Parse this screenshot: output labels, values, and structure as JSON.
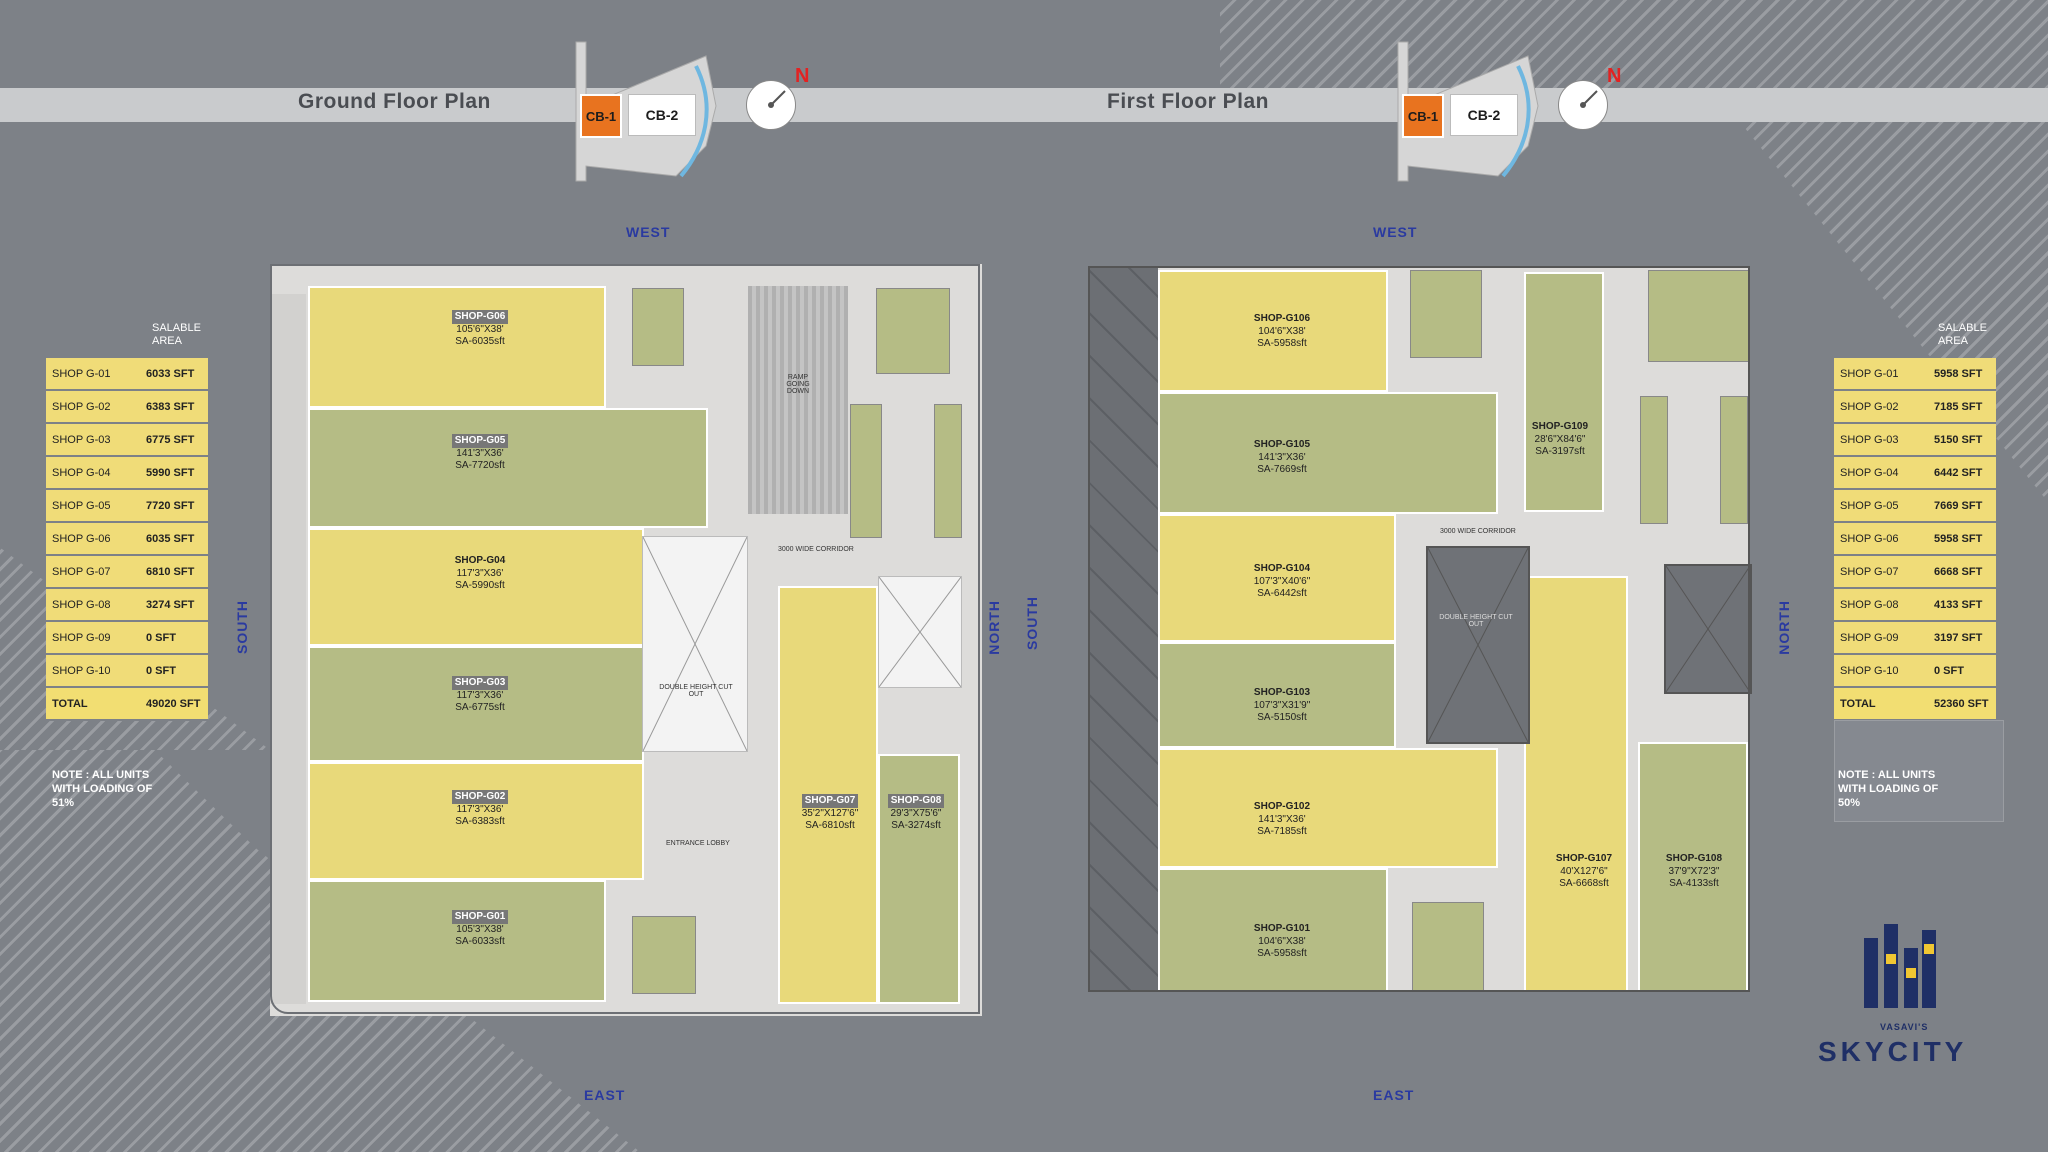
{
  "ground": {
    "title": "Ground Floor Plan",
    "key_cb1": "CB-1",
    "key_cb2": "CB-2",
    "north": "N",
    "dir_west": "WEST",
    "dir_east": "EAST",
    "dir_south": "SOUTH",
    "dir_north": "NORTH",
    "col_head": "SALABLE AREA",
    "rows": [
      {
        "name": "SHOP G-01",
        "value": "6033 SFT"
      },
      {
        "name": "SHOP G-02",
        "value": "6383 SFT"
      },
      {
        "name": "SHOP G-03",
        "value": "6775 SFT"
      },
      {
        "name": "SHOP G-04",
        "value": "5990 SFT"
      },
      {
        "name": "SHOP G-05",
        "value": "7720 SFT"
      },
      {
        "name": "SHOP G-06",
        "value": "6035 SFT"
      },
      {
        "name": "SHOP G-07",
        "value": "6810 SFT"
      },
      {
        "name": "SHOP G-08",
        "value": "3274 SFT"
      },
      {
        "name": "SHOP G-09",
        "value": "0 SFT"
      },
      {
        "name": "SHOP G-10",
        "value": "0 SFT"
      }
    ],
    "total_label": "TOTAL",
    "total_value": "49020 SFT",
    "note": "NOTE : ALL UNITS WITH LOADING OF 51%",
    "shops": [
      {
        "name": "SHOP-G06",
        "dim": "105'6\"X38'",
        "sa": "SA-6035sft"
      },
      {
        "name": "SHOP-G05",
        "dim": "141'3\"X36'",
        "sa": "SA-7720sft"
      },
      {
        "name": "SHOP-G04",
        "dim": "117'3\"X36'",
        "sa": "SA-5990sft"
      },
      {
        "name": "SHOP-G03",
        "dim": "117'3\"X36'",
        "sa": "SA-6775sft"
      },
      {
        "name": "SHOP-G02",
        "dim": "117'3\"X36'",
        "sa": "SA-6383sft"
      },
      {
        "name": "SHOP-G01",
        "dim": "105'3\"X38'",
        "sa": "SA-6033sft"
      },
      {
        "name": "SHOP-G07",
        "dim": "35'2\"X127'6\"",
        "sa": "SA-6810sft"
      },
      {
        "name": "SHOP-G08",
        "dim": "29'3\"X75'6\"",
        "sa": "SA-3274sft"
      }
    ],
    "labels": {
      "ramp": "RAMP GOING DOWN",
      "entrance_lobby": "ENTRANCE LOBBY",
      "double_height": "DOUBLE HEIGHT CUT OUT",
      "corridor": "3000 WIDE CORRIDOR"
    }
  },
  "first": {
    "title": "First Floor Plan",
    "key_cb1": "CB-1",
    "key_cb2": "CB-2",
    "north": "N",
    "dir_west": "WEST",
    "dir_east": "EAST",
    "dir_south": "SOUTH",
    "dir_north": "NORTH",
    "col_head": "SALABLE AREA",
    "rows": [
      {
        "name": "SHOP G-01",
        "value": "5958 SFT"
      },
      {
        "name": "SHOP G-02",
        "value": "7185 SFT"
      },
      {
        "name": "SHOP G-03",
        "value": "5150 SFT"
      },
      {
        "name": "SHOP G-04",
        "value": "6442 SFT"
      },
      {
        "name": "SHOP G-05",
        "value": "7669 SFT"
      },
      {
        "name": "SHOP G-06",
        "value": "5958 SFT"
      },
      {
        "name": "SHOP G-07",
        "value": "6668 SFT"
      },
      {
        "name": "SHOP G-08",
        "value": "4133 SFT"
      },
      {
        "name": "SHOP G-09",
        "value": "3197 SFT"
      },
      {
        "name": "SHOP G-10",
        "value": "0 SFT"
      }
    ],
    "total_label": "TOTAL",
    "total_value": "52360 SFT",
    "note": "NOTE : ALL UNITS WITH LOADING OF 50%",
    "shops": [
      {
        "name": "SHOP-G106",
        "dim": "104'6\"X38'",
        "sa": "SA-5958sft"
      },
      {
        "name": "SHOP-G105",
        "dim": "141'3\"X36'",
        "sa": "SA-7669sft"
      },
      {
        "name": "SHOP-G104",
        "dim": "107'3\"X40'6\"",
        "sa": "SA-6442sft"
      },
      {
        "name": "SHOP-G103",
        "dim": "107'3\"X31'9\"",
        "sa": "SA-5150sft"
      },
      {
        "name": "SHOP-G102",
        "dim": "141'3\"X36'",
        "sa": "SA-7185sft"
      },
      {
        "name": "SHOP-G101",
        "dim": "104'6\"X38'",
        "sa": "SA-5958sft"
      },
      {
        "name": "SHOP-G109",
        "dim": "28'6\"X84'6\"",
        "sa": "SA-3197sft"
      },
      {
        "name": "SHOP-G107",
        "dim": "40'X127'6\"",
        "sa": "SA-6668sft"
      },
      {
        "name": "SHOP-G108",
        "dim": "37'9\"X72'3\"",
        "sa": "SA-4133sft"
      }
    ],
    "labels": {
      "double_height": "DOUBLE HEIGHT CUT OUT",
      "corridor": "3000 WIDE CORRIDOR"
    }
  },
  "brand": {
    "pre": "VASAVI'S",
    "name": "SKYCITY",
    "color": "#1f2f66"
  },
  "colors": {
    "yellow_shop": "#e8d97a",
    "green_shop": "#b5bc85",
    "cb1": "#e8731f",
    "direction_text": "#2a3aa0"
  }
}
